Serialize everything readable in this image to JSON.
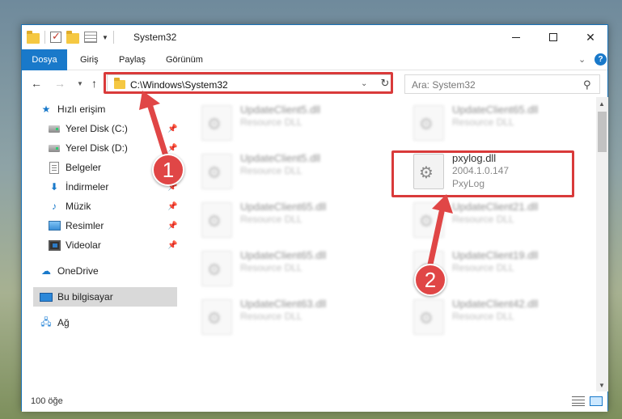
{
  "window": {
    "title": "System32",
    "controls": {
      "minimize": "minimize",
      "maximize": "maximize",
      "close": "✕"
    }
  },
  "ribbon": {
    "tabs": [
      "Dosya",
      "Giriş",
      "Paylaş",
      "Görünüm"
    ],
    "active_tab": "Dosya",
    "help": "?"
  },
  "address": {
    "path": "C:\\Windows\\System32",
    "search_placeholder": "Ara: System32"
  },
  "sidebar": {
    "quick_access": "Hızlı erişim",
    "items": [
      {
        "label": "Yerel Disk (C:)",
        "pinned": true
      },
      {
        "label": "Yerel Disk (D:)",
        "pinned": true
      },
      {
        "label": "Belgeler",
        "pinned": true
      },
      {
        "label": "İndirmeler",
        "pinned": true
      },
      {
        "label": "Müzik",
        "pinned": true
      },
      {
        "label": "Resimler",
        "pinned": true
      },
      {
        "label": "Videolar",
        "pinned": true
      }
    ],
    "onedrive": "OneDrive",
    "this_pc": "Bu bilgisayar",
    "network": "Ağ"
  },
  "files": {
    "left": [
      {
        "name": "UpdateClient5.dll",
        "desc": "Resource DLL"
      },
      {
        "name": "UpdateClient5.dll",
        "desc": "Resource DLL"
      },
      {
        "name": "UpdateClient65.dll",
        "desc": "Resource DLL"
      },
      {
        "name": "UpdateClient65.dll",
        "desc": "Resource DLL"
      },
      {
        "name": "UpdateClient63.dll",
        "desc": "Resource DLL"
      }
    ],
    "right": [
      {
        "name": "UpdateClient65.dll",
        "desc": "Resource DLL"
      },
      {
        "name": "UpdateClient21.dll",
        "desc": "Resource DLL"
      },
      {
        "name": "UpdateClient19.dll",
        "desc": "Resource DLL"
      },
      {
        "name": "UpdateClient42.dll",
        "desc": "Resource DLL"
      }
    ],
    "highlighted": {
      "name": "pxylog.dll",
      "version": "2004.1.0.147",
      "desc": "PxyLog"
    }
  },
  "status": {
    "count": "100 öğe"
  },
  "annotations": {
    "step1": "1",
    "step2": "2",
    "color": "#e04646"
  }
}
